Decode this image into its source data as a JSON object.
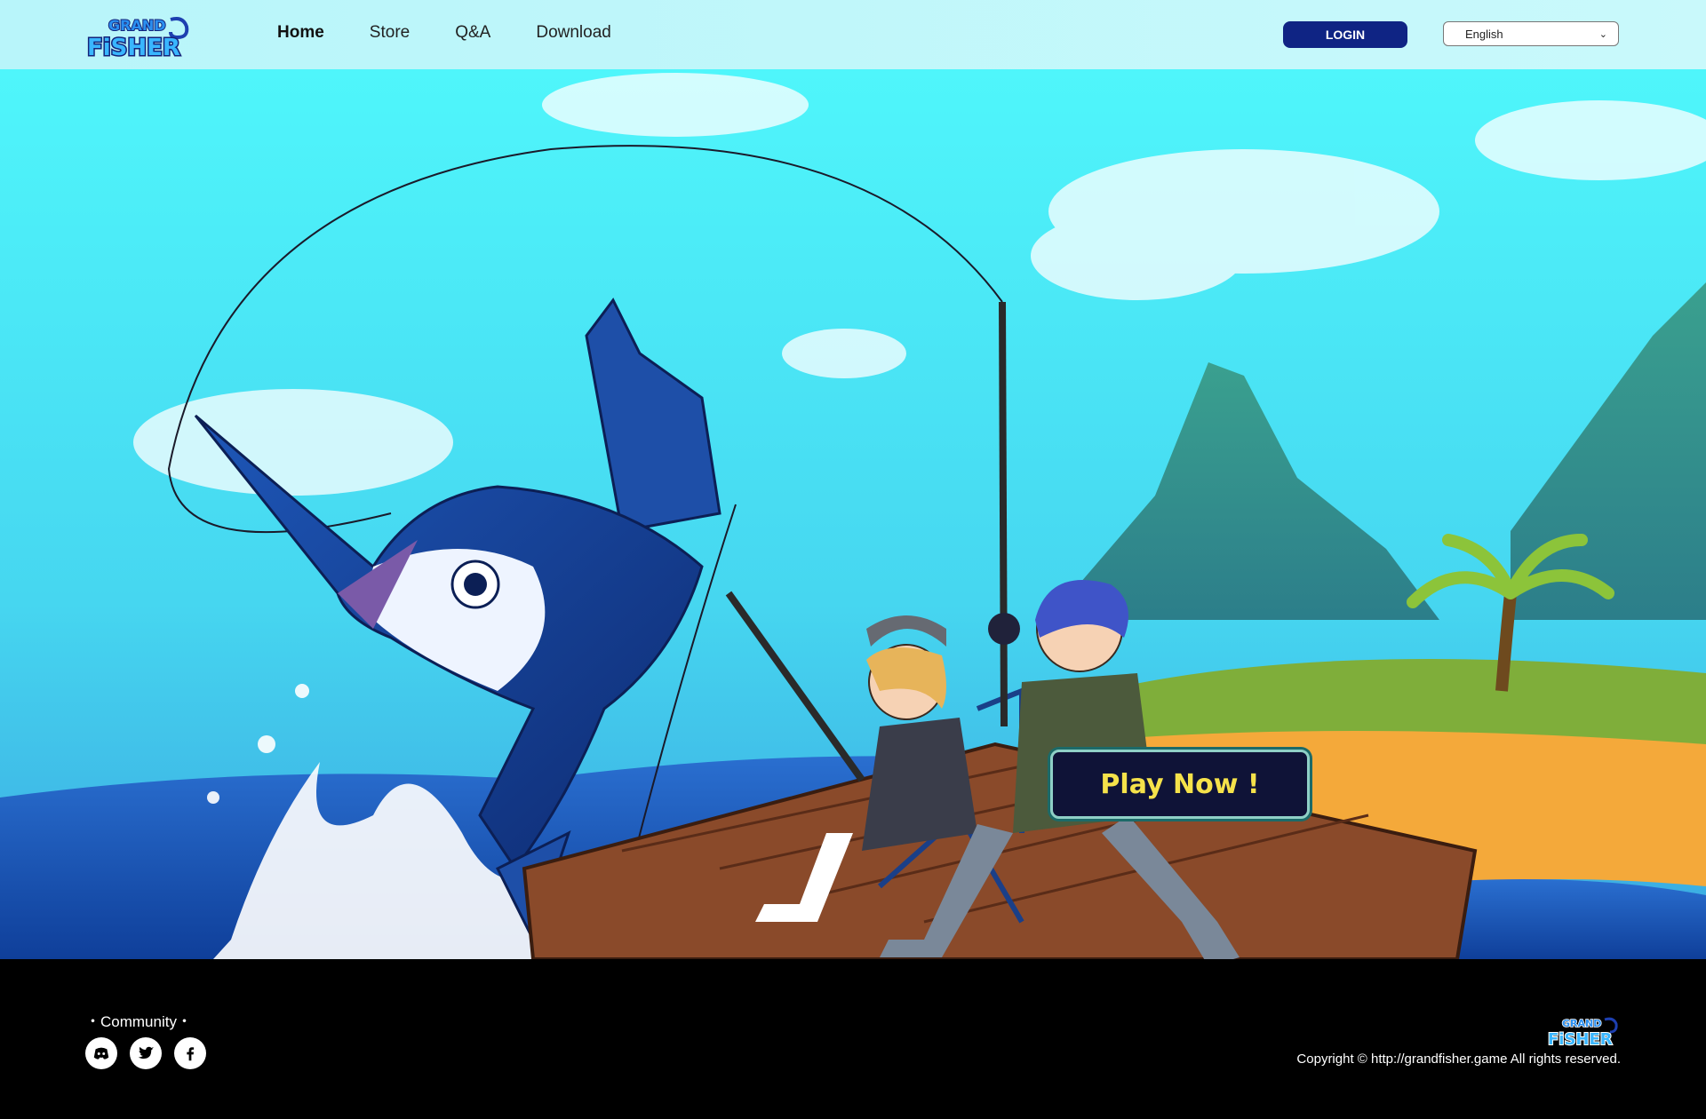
{
  "brand": {
    "logo_text_top": "GRAND",
    "logo_text_bottom": "FiSHER"
  },
  "nav": {
    "items": [
      "Home",
      "Store",
      "Q&A",
      "Download"
    ],
    "active": "Home"
  },
  "header": {
    "login_label": "LOGIN",
    "language_value": "English"
  },
  "hero": {
    "cta_label": "Play Now !"
  },
  "footer": {
    "community_label": "・Community・",
    "socials": [
      "discord-icon",
      "twitter-icon",
      "facebook-icon"
    ],
    "copyright": "Copyright © http://grandfisher.game All rights reserved."
  },
  "colors": {
    "header_bg": "#b8f5fa",
    "login_bg": "#0f2484",
    "cta_bg": "#0f1337",
    "cta_text": "#f5e24a",
    "footer_bg": "#000000"
  }
}
